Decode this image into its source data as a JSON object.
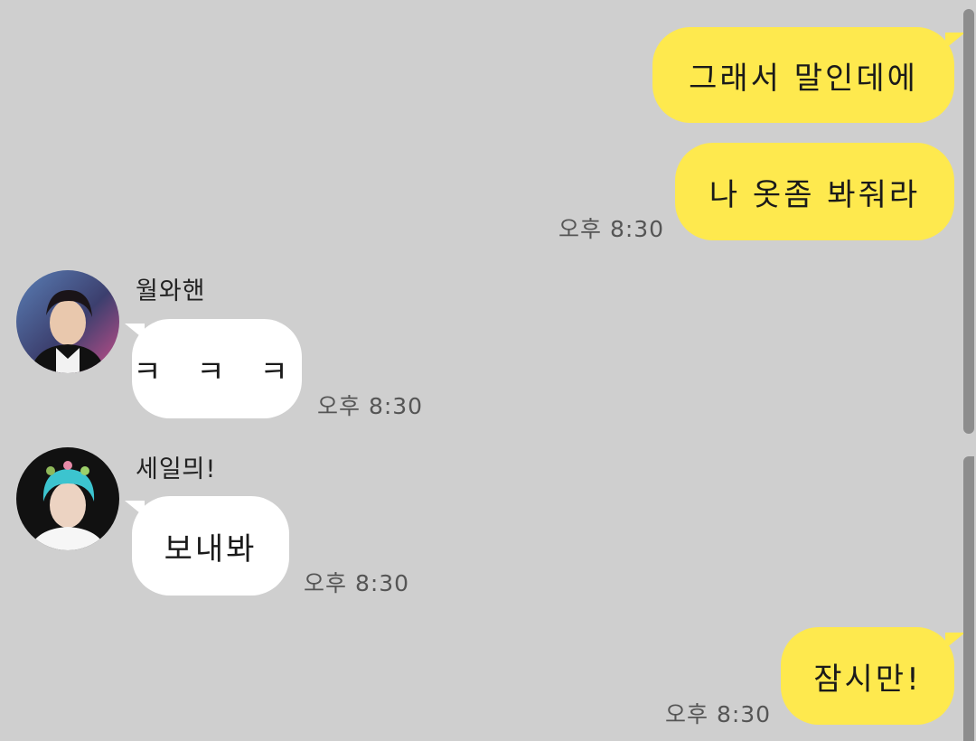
{
  "messages": [
    {
      "text": "그래서 말인데에"
    },
    {
      "text": "나 옷좀 봐줘라",
      "time": "오후 8:30"
    },
    {
      "sender": "월와핸",
      "text": "ㅋ ㅋ ㅋ",
      "time": "오후 8:30"
    },
    {
      "sender": "세일믜!",
      "text": "보내봐",
      "time": "오후 8:30"
    },
    {
      "text": "잠시만!",
      "time": "오후 8:30"
    }
  ],
  "colors": {
    "background": "#cfcfcf",
    "my_bubble": "#fee94e",
    "their_bubble": "#ffffff"
  },
  "icons": {
    "avatar_1": "profile-photo-icon",
    "avatar_2": "profile-photo-icon"
  }
}
